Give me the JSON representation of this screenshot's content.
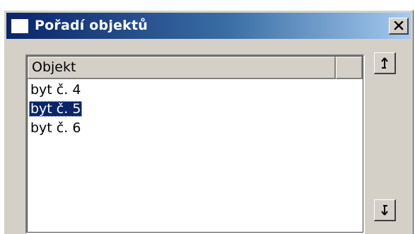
{
  "window": {
    "title": "Pořadí objektů",
    "close_glyph": "✕"
  },
  "list": {
    "columns": [
      "Objekt"
    ],
    "items": [
      {
        "label": "byt č. 4",
        "selected": false
      },
      {
        "label": "byt č. 5",
        "selected": true
      },
      {
        "label": "byt č. 6",
        "selected": false
      }
    ]
  },
  "buttons": {
    "move_up_icon": "arrow-up-icon",
    "move_down_icon": "arrow-down-icon"
  },
  "colors": {
    "titlebar_start": "#0a246a",
    "titlebar_end": "#a6caf0",
    "face": "#d4d0c8",
    "selection": "#0a246a"
  }
}
